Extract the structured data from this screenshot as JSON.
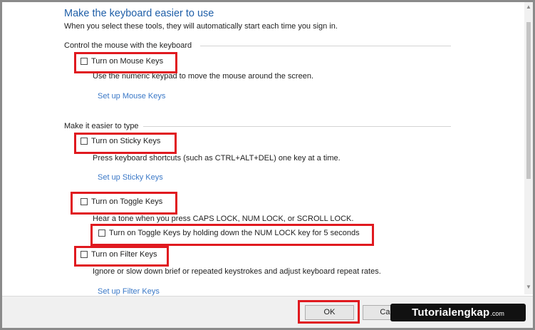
{
  "header": {
    "title": "Make the keyboard easier to use",
    "subtitle": "When you select these tools, they will automatically start each time you sign in."
  },
  "mouse_section": {
    "label": "Control the mouse with the keyboard",
    "mouse_keys": {
      "label": "Turn on Mouse Keys",
      "checked": false,
      "description": "Use the numeric keypad to move the mouse around the screen.",
      "setup_link": "Set up Mouse Keys"
    }
  },
  "typing_section": {
    "label": "Make it easier to type",
    "sticky_keys": {
      "label": "Turn on Sticky Keys",
      "checked": false,
      "description": "Press keyboard shortcuts (such as CTRL+ALT+DEL) one key at a time.",
      "setup_link": "Set up Sticky Keys"
    },
    "toggle_keys": {
      "label": "Turn on Toggle Keys",
      "checked": false,
      "description": "Hear a tone when you press CAPS LOCK, NUM LOCK, or SCROLL LOCK.",
      "sub_option": {
        "label": "Turn on Toggle Keys by holding down the NUM LOCK key for 5 seconds",
        "checked": false
      }
    },
    "filter_keys": {
      "label": "Turn on Filter Keys",
      "checked": false,
      "description": "Ignore or slow down brief or repeated keystrokes and adjust keyboard repeat rates.",
      "setup_link": "Set up Filter Keys"
    }
  },
  "footer": {
    "ok_label": "OK",
    "cancel_label": "Can"
  },
  "watermark": {
    "main": "Tutorialengkap",
    "suffix": ".com"
  },
  "colors": {
    "highlight": "#e0191f",
    "title": "#1f5fa8",
    "link": "#3a78c7"
  }
}
